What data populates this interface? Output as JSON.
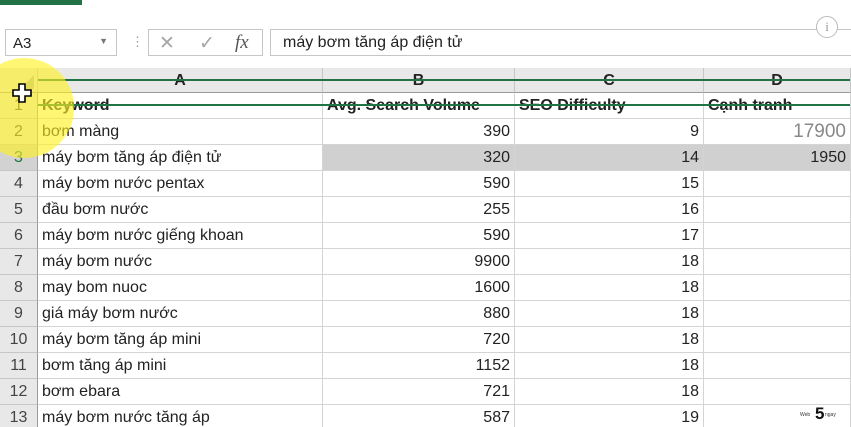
{
  "namebox": {
    "value": "A3",
    "dropdown_icon": "chevron-down-icon"
  },
  "formula_bar": {
    "cancel_icon": "close-icon",
    "enter_icon": "check-icon",
    "fx_label": "fx",
    "content": "máy bơm tăng áp điện tử"
  },
  "info_icon": "i",
  "columns": [
    "A",
    "B",
    "C",
    "D"
  ],
  "rows": [
    {
      "num": "1",
      "a": "Keyword",
      "b": "Avg. Search Volume",
      "c": "SEO Difficulty",
      "d": "Cạnh tranh"
    },
    {
      "num": "2",
      "a": "bơm màng",
      "b": "390",
      "c": "9",
      "d": "17900"
    },
    {
      "num": "3",
      "a": "máy bơm tăng áp điện tử",
      "b": "320",
      "c": "14",
      "d": "1950"
    },
    {
      "num": "4",
      "a": "máy bơm nước pentax",
      "b": "590",
      "c": "15",
      "d": ""
    },
    {
      "num": "5",
      "a": "đầu bơm nước",
      "b": "255",
      "c": "16",
      "d": ""
    },
    {
      "num": "6",
      "a": "máy bơm nước giếng khoan",
      "b": "590",
      "c": "17",
      "d": ""
    },
    {
      "num": "7",
      "a": "máy bơm nước",
      "b": "9900",
      "c": "18",
      "d": ""
    },
    {
      "num": "8",
      "a": "may bom nuoc",
      "b": "1600",
      "c": "18",
      "d": ""
    },
    {
      "num": "9",
      "a": "giá máy bơm nước",
      "b": "880",
      "c": "18",
      "d": ""
    },
    {
      "num": "10",
      "a": "máy bơm tăng áp mini",
      "b": "720",
      "c": "18",
      "d": ""
    },
    {
      "num": "11",
      "a": "bơm tăng áp mini",
      "b": "1152",
      "c": "18",
      "d": ""
    },
    {
      "num": "12",
      "a": "bơm ebara",
      "b": "721",
      "c": "18",
      "d": ""
    },
    {
      "num": "13",
      "a": "máy bơm nước tăng áp",
      "b": "587",
      "c": "19",
      "d": ""
    }
  ],
  "selected_cell": "A3",
  "colors": {
    "accent": "#217346",
    "highlight": "#d0d0d0",
    "cursor_spotlight": "#fff01e"
  },
  "watermark": {
    "left_text": "Web",
    "number": "5",
    "right_text": "ngay"
  }
}
